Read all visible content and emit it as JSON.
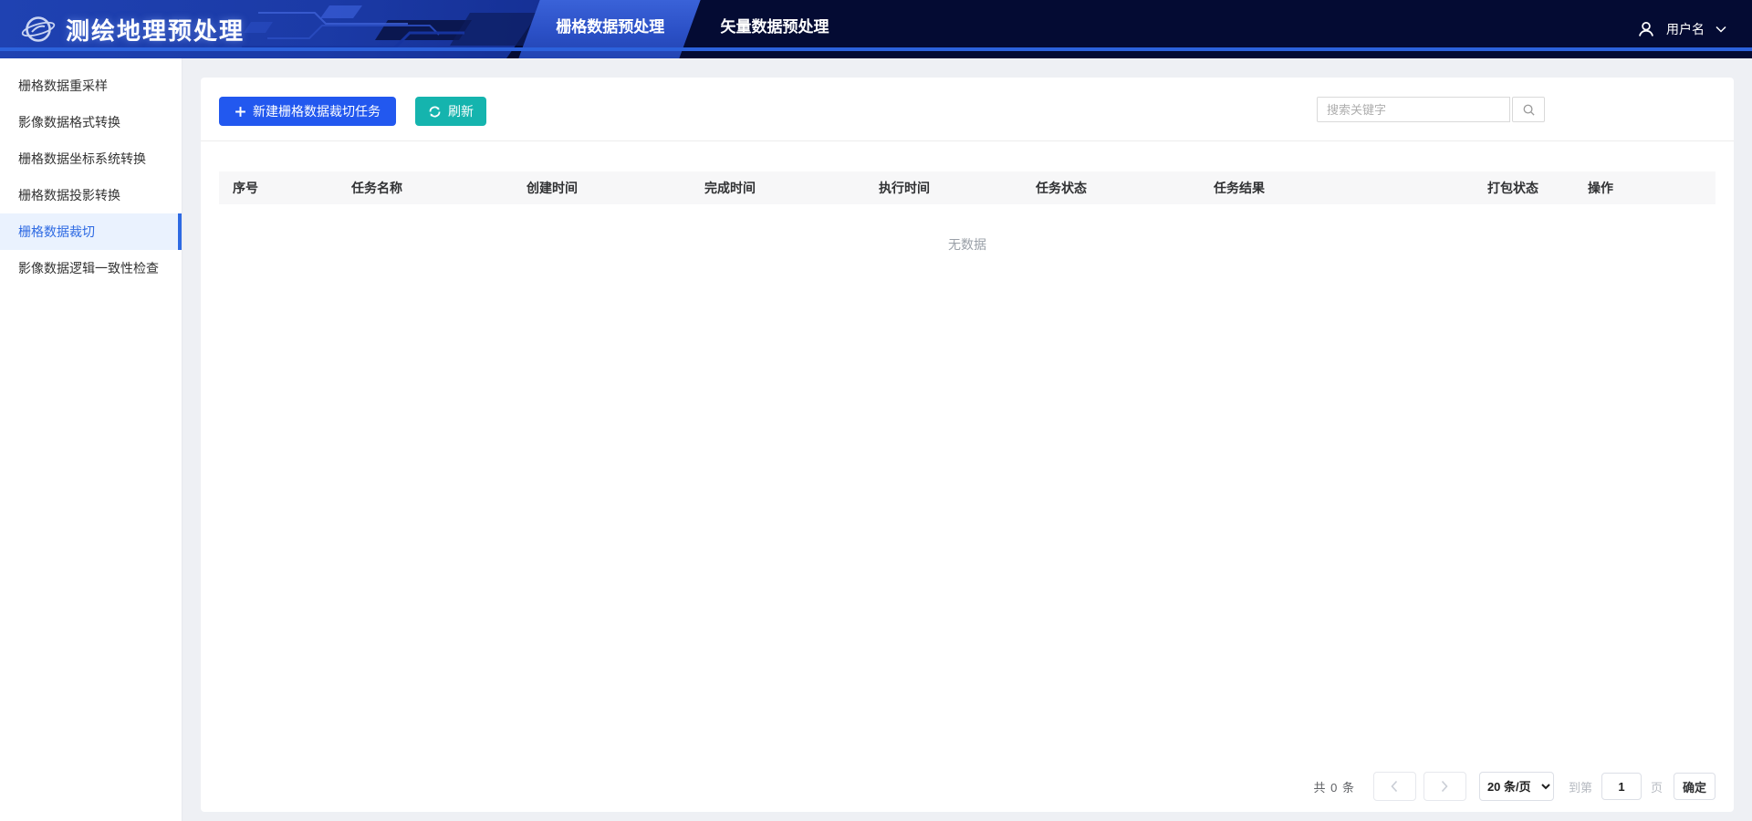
{
  "app": {
    "title": "测绘地理预处理",
    "user_name": "用户名"
  },
  "header": {
    "tabs": [
      {
        "label": "栅格数据预处理",
        "active": true
      },
      {
        "label": "矢量数据预处理",
        "active": false
      }
    ]
  },
  "sidebar": {
    "items": [
      {
        "label": "栅格数据重采样",
        "active": false
      },
      {
        "label": "影像数据格式转换",
        "active": false
      },
      {
        "label": "栅格数据坐标系统转换",
        "active": false
      },
      {
        "label": "栅格数据投影转换",
        "active": false
      },
      {
        "label": "栅格数据裁切",
        "active": true
      },
      {
        "label": "影像数据逻辑一致性检查",
        "active": false
      }
    ]
  },
  "toolbar": {
    "new_task_label": "新建栅格数据裁切任务",
    "refresh_label": "刷新",
    "search_placeholder": "搜索关键字"
  },
  "table": {
    "columns": [
      "序号",
      "任务名称",
      "创建时间",
      "完成时间",
      "执行时间",
      "任务状态",
      "任务结果",
      "打包状态",
      "操作"
    ],
    "rows": [],
    "empty_text": "无数据"
  },
  "pagination": {
    "total_text": "共 0 条",
    "page_size_label": "20 条/页",
    "goto_prefix": "到第",
    "current_page": "1",
    "goto_suffix": "页",
    "confirm_label": "确定"
  },
  "colors": {
    "header_navy": "#040b33",
    "header_blue": "#1f42b2",
    "accent_line": "#2c62dc",
    "primary_button": "#2258ef",
    "teal_button": "#15b4ae",
    "sidebar_active_bg": "#eaf2fe",
    "sidebar_active_text": "#2e6ae3",
    "table_header_bg": "#f7f7f8",
    "page_bg": "#eef0f4"
  }
}
